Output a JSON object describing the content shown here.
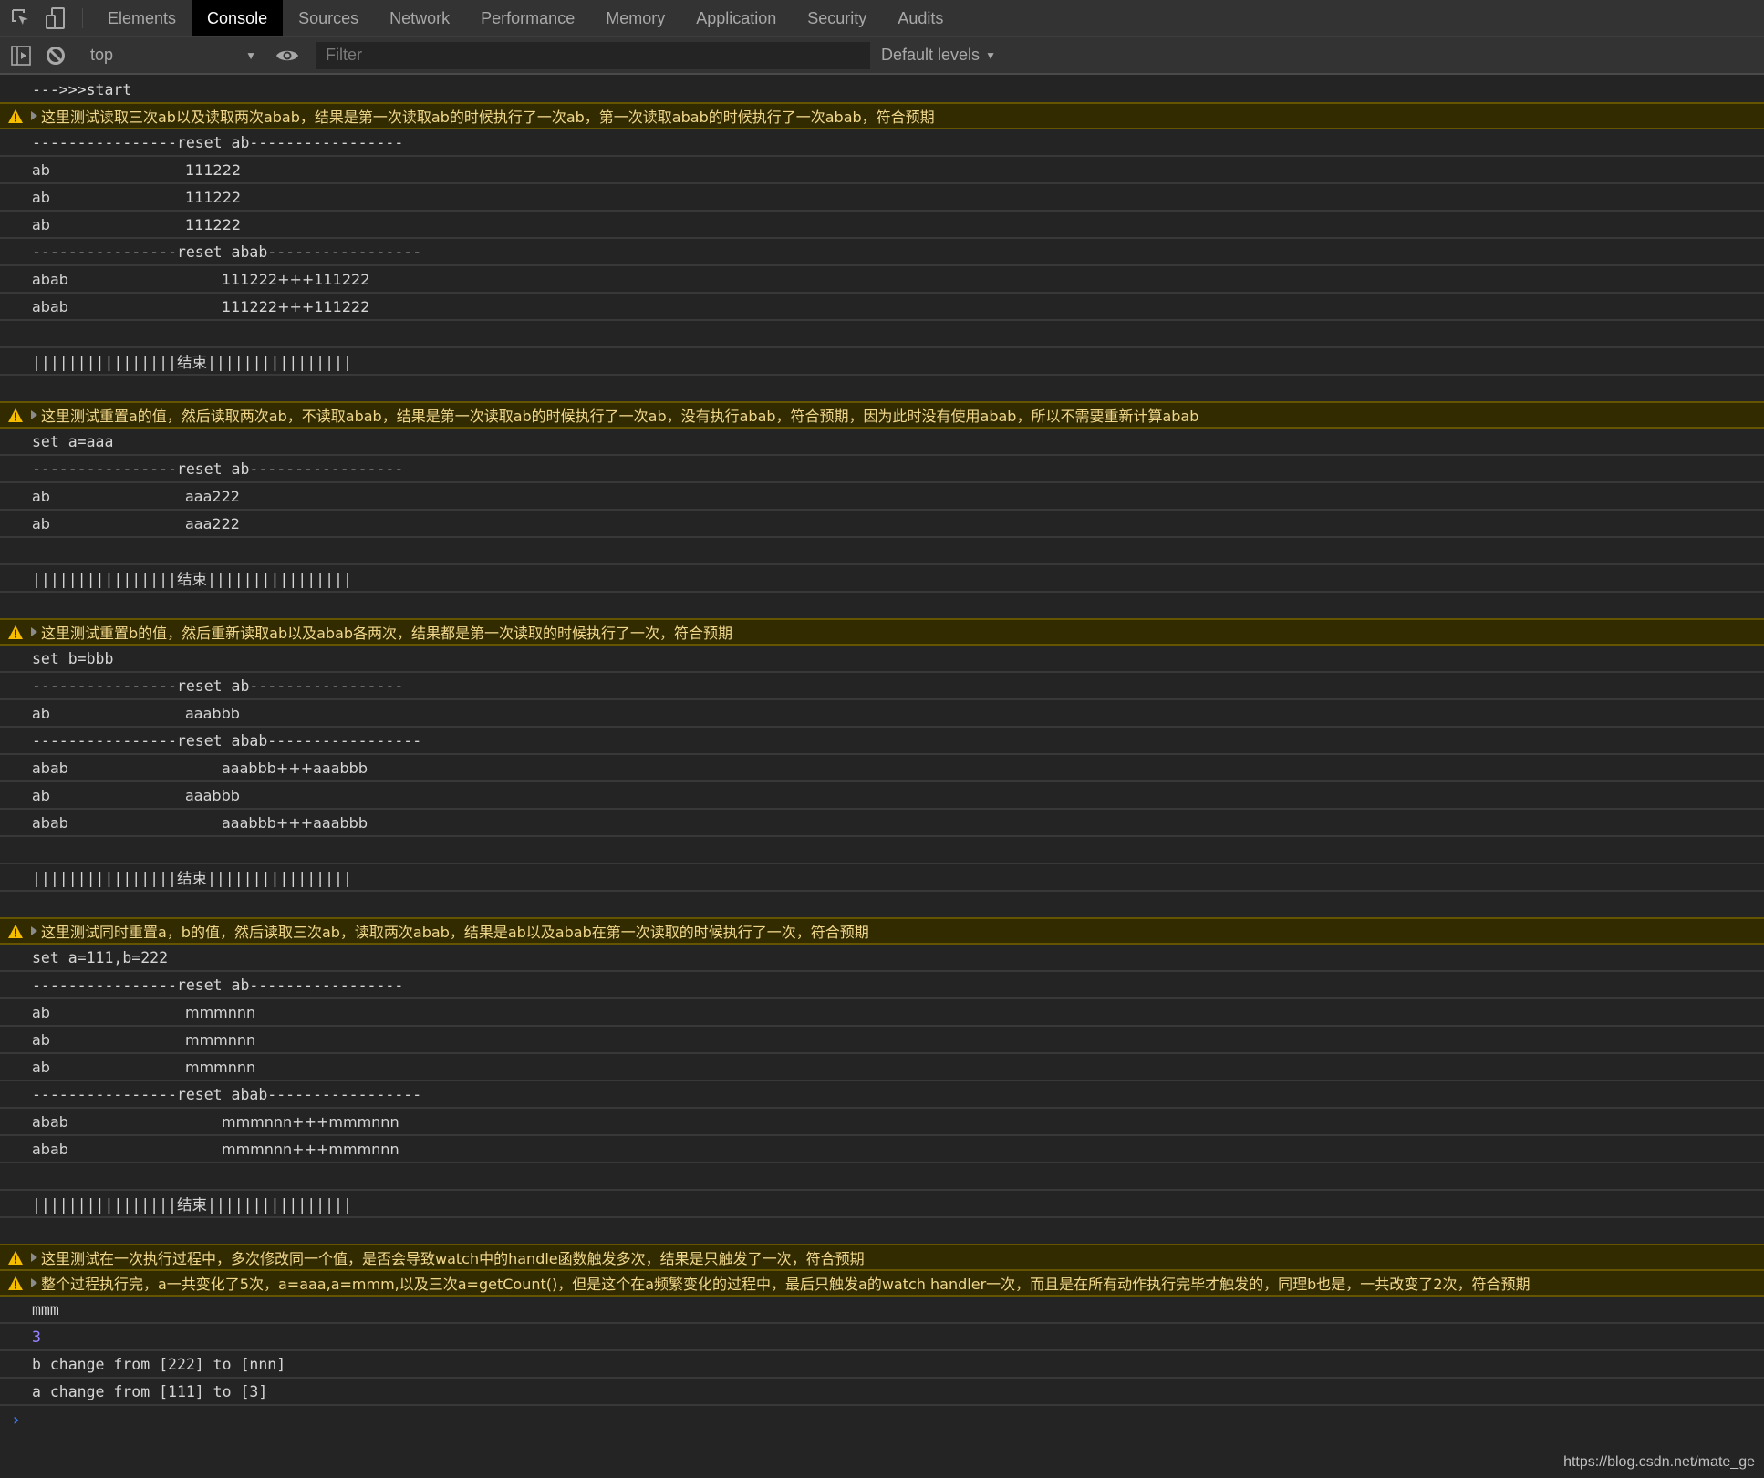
{
  "tabs": [
    "Elements",
    "Console",
    "Sources",
    "Network",
    "Performance",
    "Memory",
    "Application",
    "Security",
    "Audits"
  ],
  "active_tab": "Console",
  "toolbar": {
    "context": "top",
    "filter_placeholder": "Filter",
    "filter_value": "",
    "levels": "Default levels"
  },
  "colors": {
    "background": "#242424",
    "toolbar": "#333333",
    "warning_bg": "#332b00",
    "warning_border": "#665500",
    "warning_text": "#f0d78c",
    "number": "#9980ff",
    "prompt": "#367cf1"
  },
  "logs": [
    {
      "type": "log",
      "text": "--->>>start"
    },
    {
      "type": "warn",
      "text": "这里测试读取三次ab以及读取两次abab，结果是第一次读取ab的时候执行了一次ab，第一次读取abab的时候执行了一次abab，符合预期"
    },
    {
      "type": "log",
      "text": "----------------reset ab-----------------"
    },
    {
      "type": "kv",
      "label": "ab",
      "value": "111222"
    },
    {
      "type": "kv",
      "label": "ab",
      "value": "111222"
    },
    {
      "type": "kv",
      "label": "ab",
      "value": "111222"
    },
    {
      "type": "log",
      "text": "----------------reset abab-----------------"
    },
    {
      "type": "kv",
      "label": "abab",
      "value": "111222+++111222"
    },
    {
      "type": "kv",
      "label": "abab",
      "value": "111222+++111222"
    },
    {
      "type": "log",
      "text": ""
    },
    {
      "type": "log",
      "text": "||||||||||||||||结束||||||||||||||||"
    },
    {
      "type": "log",
      "text": ""
    },
    {
      "type": "warn",
      "text": "这里测试重置a的值，然后读取两次ab，不读取abab，结果是第一次读取ab的时候执行了一次ab，没有执行abab，符合预期，因为此时没有使用abab，所以不需要重新计算abab"
    },
    {
      "type": "log",
      "text": "set a=aaa"
    },
    {
      "type": "log",
      "text": "----------------reset ab-----------------"
    },
    {
      "type": "kv",
      "label": "ab",
      "value": "aaa222"
    },
    {
      "type": "kv",
      "label": "ab",
      "value": "aaa222"
    },
    {
      "type": "log",
      "text": ""
    },
    {
      "type": "log",
      "text": "||||||||||||||||结束||||||||||||||||"
    },
    {
      "type": "log",
      "text": ""
    },
    {
      "type": "warn",
      "text": "这里测试重置b的值，然后重新读取ab以及abab各两次，结果都是第一次读取的时候执行了一次，符合预期"
    },
    {
      "type": "log",
      "text": "set b=bbb"
    },
    {
      "type": "log",
      "text": "----------------reset ab-----------------"
    },
    {
      "type": "kv",
      "label": "ab",
      "value": "aaabbb"
    },
    {
      "type": "log",
      "text": "----------------reset abab-----------------"
    },
    {
      "type": "kv",
      "label": "abab",
      "value": "aaabbb+++aaabbb"
    },
    {
      "type": "kv",
      "label": "ab",
      "value": "aaabbb"
    },
    {
      "type": "kv",
      "label": "abab",
      "value": "aaabbb+++aaabbb"
    },
    {
      "type": "log",
      "text": ""
    },
    {
      "type": "log",
      "text": "||||||||||||||||结束||||||||||||||||"
    },
    {
      "type": "log",
      "text": ""
    },
    {
      "type": "warn",
      "text": "这里测试同时重置a，b的值，然后读取三次ab，读取两次abab，结果是ab以及abab在第一次读取的时候执行了一次，符合预期"
    },
    {
      "type": "log",
      "text": "set a=111,b=222"
    },
    {
      "type": "log",
      "text": "----------------reset ab-----------------"
    },
    {
      "type": "kv",
      "label": "ab",
      "value": "mmmnnn"
    },
    {
      "type": "kv",
      "label": "ab",
      "value": "mmmnnn"
    },
    {
      "type": "kv",
      "label": "ab",
      "value": "mmmnnn"
    },
    {
      "type": "log",
      "text": "----------------reset abab-----------------"
    },
    {
      "type": "kv",
      "label": "abab",
      "value": "mmmnnn+++mmmnnn"
    },
    {
      "type": "kv",
      "label": "abab",
      "value": "mmmnnn+++mmmnnn"
    },
    {
      "type": "log",
      "text": ""
    },
    {
      "type": "log",
      "text": "||||||||||||||||结束||||||||||||||||"
    },
    {
      "type": "log",
      "text": ""
    },
    {
      "type": "warn",
      "text": "这里测试在一次执行过程中，多次修改同一个值，是否会导致watch中的handle函数触发多次，结果是只触发了一次，符合预期"
    },
    {
      "type": "warn",
      "text": "整个过程执行完，a一共变化了5次，a=aaa,a=mmm,以及三次a=getCount()，但是这个在a频繁变化的过程中，最后只触发a的watch handler一次，而且是在所有动作执行完毕才触发的，同理b也是，一共改变了2次，符合预期"
    },
    {
      "type": "log",
      "text": "mmm"
    },
    {
      "type": "num",
      "text": "3"
    },
    {
      "type": "log",
      "text": "b change from [222] to [nnn]"
    },
    {
      "type": "log",
      "text": "a change from [111] to [3]"
    }
  ],
  "watermark": "https://blog.csdn.net/mate_ge"
}
